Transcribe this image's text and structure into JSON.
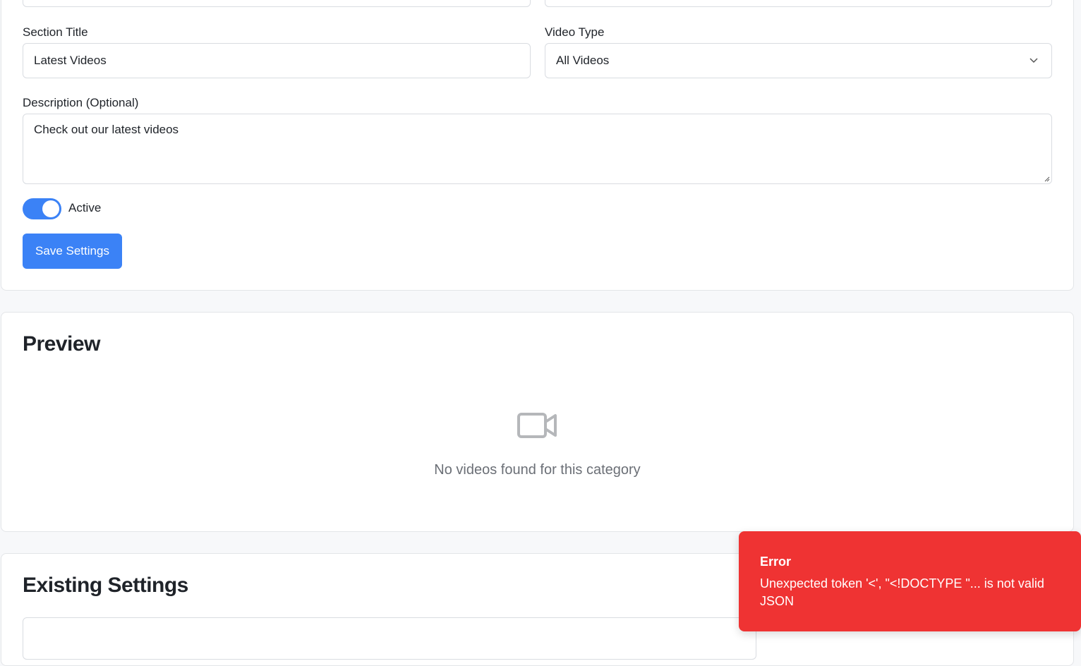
{
  "form": {
    "section_title_label": "Section Title",
    "section_title_value": "Latest Videos",
    "video_type_label": "Video Type",
    "video_type_value": "All Videos",
    "description_label": "Description (Optional)",
    "description_value": "Check out our latest videos",
    "active_label": "Active",
    "active_on": true,
    "save_button": "Save Settings"
  },
  "preview": {
    "heading": "Preview",
    "empty_icon": "video-camera-icon",
    "empty_message": "No videos found for this category"
  },
  "existing": {
    "heading": "Existing Settings"
  },
  "toast": {
    "title": "Error",
    "message": "Unexpected token '<', \"<!DOCTYPE \"... is not valid JSON"
  },
  "colors": {
    "primary": "#3b82f6",
    "error": "#ef3333"
  }
}
